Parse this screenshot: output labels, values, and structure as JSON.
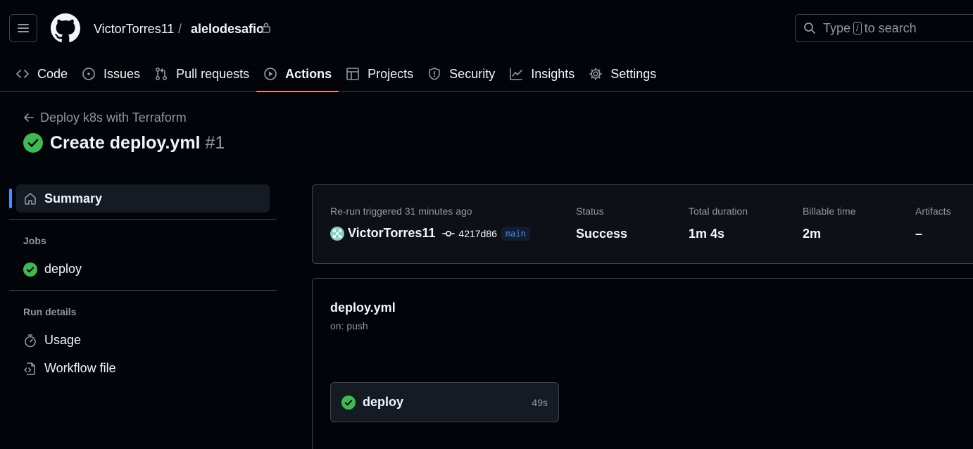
{
  "header": {
    "owner": "VictorTorres11",
    "separator": "/",
    "repo": "alelodesafio",
    "search": {
      "before": "Type",
      "key": "/",
      "after": "to search"
    }
  },
  "tabs": [
    {
      "label": "Code",
      "icon": "code-icon"
    },
    {
      "label": "Issues",
      "icon": "issue-icon"
    },
    {
      "label": "Pull requests",
      "icon": "pull-request-icon"
    },
    {
      "label": "Actions",
      "icon": "play-icon",
      "active": true
    },
    {
      "label": "Projects",
      "icon": "table-icon"
    },
    {
      "label": "Security",
      "icon": "shield-icon"
    },
    {
      "label": "Insights",
      "icon": "graph-icon"
    },
    {
      "label": "Settings",
      "icon": "gear-icon"
    }
  ],
  "workflow": {
    "back_label": "Deploy k8s with Terraform",
    "run_title": "Create deploy.yml",
    "run_number": "#1"
  },
  "sidebar": {
    "summary": "Summary",
    "jobs_heading": "Jobs",
    "job": "deploy",
    "run_details_heading": "Run details",
    "usage": "Usage",
    "workflow_file": "Workflow file"
  },
  "summary_card": {
    "trigger": "Re-run triggered 31 minutes ago",
    "user": "VictorTorres11",
    "commit": "4217d86",
    "branch": "main",
    "status_label": "Status",
    "status_value": "Success",
    "duration_label": "Total duration",
    "duration_value": "1m 4s",
    "billable_label": "Billable time",
    "billable_value": "2m",
    "artifacts_label": "Artifacts",
    "artifacts_value": "–"
  },
  "graph": {
    "file": "deploy.yml",
    "trigger": "on: push",
    "job_name": "deploy",
    "job_duration": "49s"
  },
  "colors": {
    "background": "#010409",
    "border": "#3d444d",
    "success": "#3fb950",
    "accent_tab": "#f78166",
    "link_blue": "#4493f8"
  }
}
